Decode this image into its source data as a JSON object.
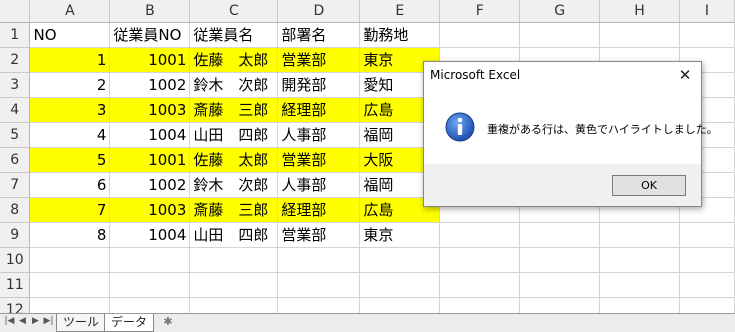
{
  "columns": [
    "A",
    "B",
    "C",
    "D",
    "E",
    "F",
    "G",
    "H",
    "I"
  ],
  "rows": [
    {
      "num": "1",
      "a": "NO",
      "b": "従業員NO",
      "c": "従業員名",
      "d": "部署名",
      "e": "勤務地",
      "hl": false
    },
    {
      "num": "2",
      "a": "1",
      "b": "1001",
      "c": "佐藤　太郎",
      "d": "営業部",
      "e": "東京",
      "hl": true
    },
    {
      "num": "3",
      "a": "2",
      "b": "1002",
      "c": "鈴木　次郎",
      "d": "開発部",
      "e": "愛知",
      "hl": false
    },
    {
      "num": "4",
      "a": "3",
      "b": "1003",
      "c": "斎藤　三郎",
      "d": "経理部",
      "e": "広島",
      "hl": true
    },
    {
      "num": "5",
      "a": "4",
      "b": "1004",
      "c": "山田　四郎",
      "d": "人事部",
      "e": "福岡",
      "hl": false
    },
    {
      "num": "6",
      "a": "5",
      "b": "1001",
      "c": "佐藤　太郎",
      "d": "営業部",
      "e": "大阪",
      "hl": true
    },
    {
      "num": "7",
      "a": "6",
      "b": "1002",
      "c": "鈴木　次郎",
      "d": "人事部",
      "e": "福岡",
      "hl": false
    },
    {
      "num": "8",
      "a": "7",
      "b": "1003",
      "c": "斎藤　三郎",
      "d": "経理部",
      "e": "広島",
      "hl": true
    },
    {
      "num": "9",
      "a": "8",
      "b": "1004",
      "c": "山田　四郎",
      "d": "営業部",
      "e": "東京",
      "hl": false
    },
    {
      "num": "10",
      "a": "",
      "b": "",
      "c": "",
      "d": "",
      "e": "",
      "hl": false
    },
    {
      "num": "11",
      "a": "",
      "b": "",
      "c": "",
      "d": "",
      "e": "",
      "hl": false
    },
    {
      "num": "12",
      "a": "",
      "b": "",
      "c": "",
      "d": "",
      "e": "",
      "hl": false
    }
  ],
  "sheet_tabs": [
    "ツール",
    "データ"
  ],
  "active_tab": "データ",
  "colors": {
    "highlight": "#ffff00"
  },
  "dialog": {
    "title": "Microsoft Excel",
    "message": "重複がある行は、黄色でハイライトしました。",
    "ok_label": "OK",
    "icon": "info-icon",
    "close_icon": "close-icon"
  }
}
